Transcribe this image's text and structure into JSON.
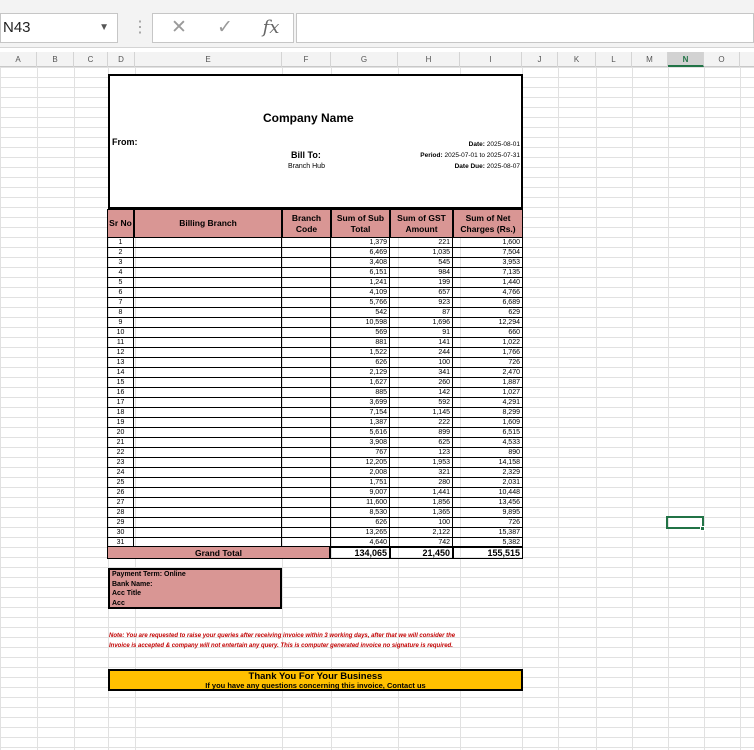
{
  "namebox": {
    "value": "N43"
  },
  "formula": {
    "value": "",
    "fx": "fx"
  },
  "columns": [
    "A",
    "B",
    "C",
    "D",
    "E",
    "F",
    "G",
    "H",
    "I",
    "J",
    "K",
    "L",
    "M",
    "N",
    "O"
  ],
  "invoice": {
    "company": "Company Name",
    "from_label": "From:",
    "bill_to_label": "Bill To:",
    "bill_to_value": "Branch Hub",
    "date_label": "Date:",
    "date_value": "2025-08-01",
    "period_label": "Period:",
    "period_value": "2025-07-01 to 2025-07-31",
    "due_label": "Date Due:",
    "due_value": "2025-08-07"
  },
  "table": {
    "headers": [
      "Sr No",
      "Billing Branch",
      "Branch Code",
      "Sum of Sub Total",
      "Sum of GST Amount",
      "Sum of Net Charges (Rs.)"
    ],
    "rows": [
      [
        "1",
        "1,379",
        "221",
        "1,600"
      ],
      [
        "2",
        "6,469",
        "1,035",
        "7,504"
      ],
      [
        "3",
        "3,408",
        "545",
        "3,953"
      ],
      [
        "4",
        "6,151",
        "984",
        "7,135"
      ],
      [
        "5",
        "1,241",
        "199",
        "1,440"
      ],
      [
        "6",
        "4,109",
        "657",
        "4,766"
      ],
      [
        "7",
        "5,766",
        "923",
        "6,689"
      ],
      [
        "8",
        "542",
        "87",
        "629"
      ],
      [
        "9",
        "10,598",
        "1,696",
        "12,294"
      ],
      [
        "10",
        "569",
        "91",
        "660"
      ],
      [
        "11",
        "881",
        "141",
        "1,022"
      ],
      [
        "12",
        "1,522",
        "244",
        "1,766"
      ],
      [
        "13",
        "626",
        "100",
        "726"
      ],
      [
        "14",
        "2,129",
        "341",
        "2,470"
      ],
      [
        "15",
        "1,627",
        "260",
        "1,887"
      ],
      [
        "16",
        "885",
        "142",
        "1,027"
      ],
      [
        "17",
        "3,699",
        "592",
        "4,291"
      ],
      [
        "18",
        "7,154",
        "1,145",
        "8,299"
      ],
      [
        "19",
        "1,387",
        "222",
        "1,609"
      ],
      [
        "20",
        "5,616",
        "899",
        "6,515"
      ],
      [
        "21",
        "3,908",
        "625",
        "4,533"
      ],
      [
        "22",
        "767",
        "123",
        "890"
      ],
      [
        "23",
        "12,205",
        "1,953",
        "14,158"
      ],
      [
        "24",
        "2,008",
        "321",
        "2,329"
      ],
      [
        "25",
        "1,751",
        "280",
        "2,031"
      ],
      [
        "26",
        "9,007",
        "1,441",
        "10,448"
      ],
      [
        "27",
        "11,600",
        "1,856",
        "13,456"
      ],
      [
        "28",
        "8,530",
        "1,365",
        "9,895"
      ],
      [
        "29",
        "626",
        "100",
        "726"
      ],
      [
        "30",
        "13,265",
        "2,122",
        "15,387"
      ],
      [
        "31",
        "4,640",
        "742",
        "5,382"
      ]
    ],
    "grand_total_label": "Grand Total",
    "grand_sub": "134,065",
    "grand_gst": "21,450",
    "grand_net": "155,515"
  },
  "payment": {
    "term": "Payment Term: Online",
    "bank": "Bank Name:",
    "acc_title": "Acc Title",
    "acc": "Acc"
  },
  "note": {
    "line1": "Note: You are requested to raise your queries after receiving invoice within 3 working days, after that we will consider the",
    "line2": "Invoice is accepted & company will not entertain any query. This is computer generated invoice no signature is required."
  },
  "footer": {
    "thanks": "Thank You For Your Business",
    "contact": "If you have any questions concerning this invoice, Contact us"
  },
  "colors": {
    "header_fill": "#d99694",
    "footer_fill": "#ffc000",
    "note_text": "#c00000",
    "selection": "#217346"
  }
}
